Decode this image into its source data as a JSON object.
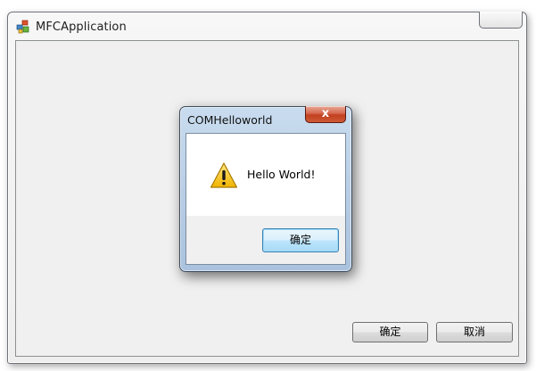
{
  "main_window": {
    "title": "MFCApplication",
    "icon": "mfc-app-icon",
    "ok_label": "确定",
    "cancel_label": "取消"
  },
  "message_box": {
    "title": "COMHelloworld",
    "close_label": "x",
    "icon": "warning-icon",
    "message": "Hello World!",
    "ok_label": "确定"
  },
  "colors": {
    "dialog_frame": "#b6cce4",
    "close_button": "#c1401f",
    "default_button_border": "#3c7fb1",
    "warning_yellow": "#f4c20d"
  }
}
